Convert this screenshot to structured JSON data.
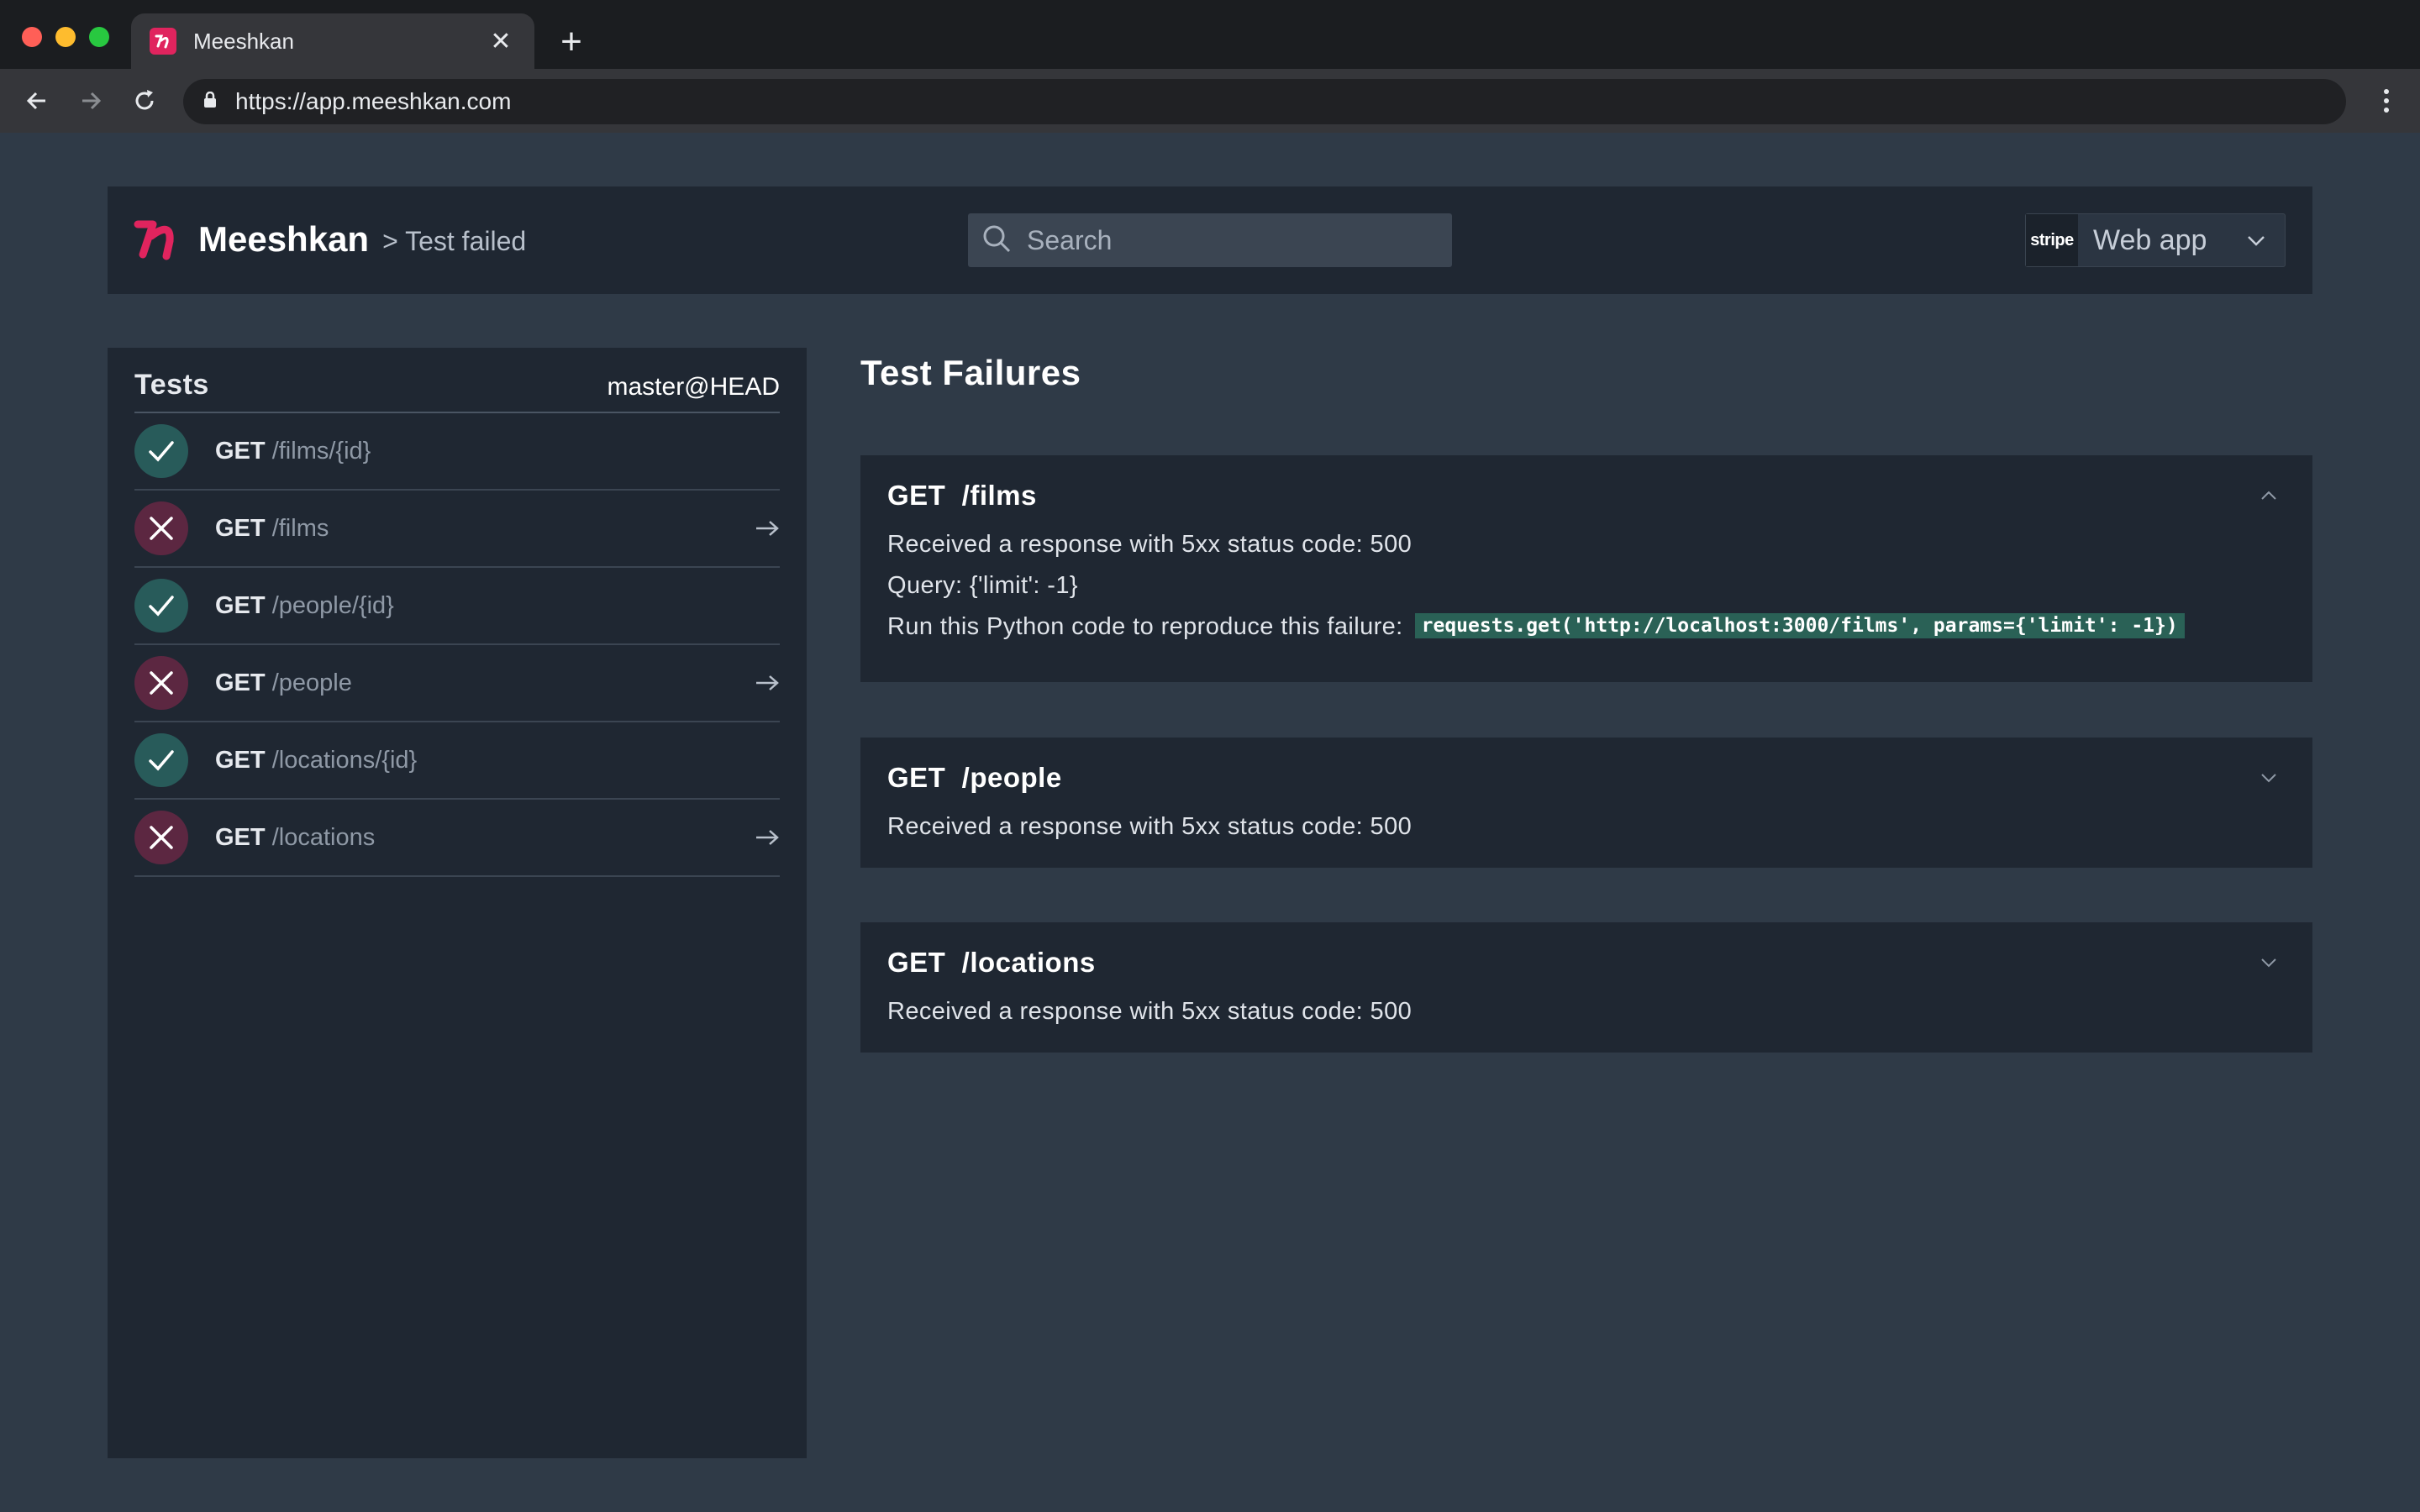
{
  "browser": {
    "tab_title": "Meeshkan",
    "new_tab_label": "+",
    "close_tab_label": "✕",
    "url": "https://app.meeshkan.com"
  },
  "header": {
    "brand": "Meeshkan",
    "breadcrumb": "> Test failed",
    "search_placeholder": "Search",
    "project_badge": "stripe",
    "project_name": "Web app"
  },
  "sidebar": {
    "title": "Tests",
    "branch": "master@HEAD",
    "items": [
      {
        "method": "GET",
        "path": "/films/{id}",
        "status": "pass"
      },
      {
        "method": "GET",
        "path": "/films",
        "status": "fail"
      },
      {
        "method": "GET",
        "path": "/people/{id}",
        "status": "pass"
      },
      {
        "method": "GET",
        "path": "/people",
        "status": "fail"
      },
      {
        "method": "GET",
        "path": "/locations/{id}",
        "status": "pass"
      },
      {
        "method": "GET",
        "path": "/locations",
        "status": "fail"
      }
    ]
  },
  "main": {
    "title": "Test Failures",
    "failures": [
      {
        "title": "GET  /films",
        "message": "Received a response with 5xx status code: 500",
        "query": "Query: {'limit': -1}",
        "reproduce_label": "Run this Python code to reproduce this failure:",
        "code": "requests.get('http://localhost:3000/films', params={'limit': -1})",
        "expanded": true
      },
      {
        "title": "GET  /people",
        "message": "Received a response with 5xx status code: 500",
        "expanded": false
      },
      {
        "title": "GET  /locations",
        "message": "Received a response with 5xx status code: 500",
        "expanded": false
      }
    ]
  },
  "colors": {
    "accent": "#e0245e",
    "pass": "#285b5a",
    "fail": "#5c2741",
    "code_bg": "#2a6156"
  }
}
